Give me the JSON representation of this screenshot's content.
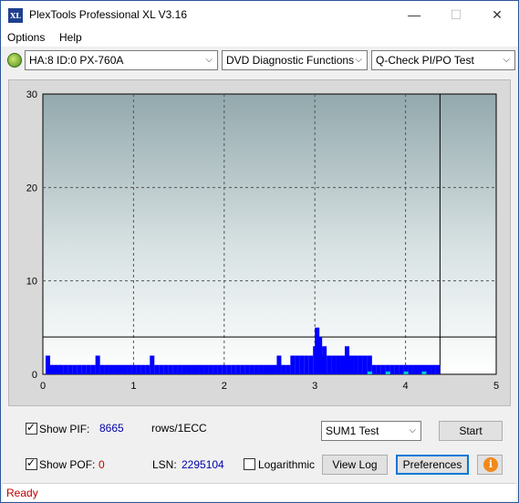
{
  "window": {
    "title": "PlexTools Professional XL V3.16",
    "logo_text": "XL",
    "min_glyph": "—",
    "max_glyph": "☐",
    "close_glyph": "✕"
  },
  "menu": {
    "options": "Options",
    "help": "Help"
  },
  "toolbar": {
    "drive": "HA:8 ID:0  PX-760A",
    "function": "DVD Diagnostic Functions",
    "test": "Q-Check PI/PO Test",
    "arrow": "⌵"
  },
  "chart_data": {
    "type": "bar",
    "xlim": [
      0,
      5
    ],
    "ylim": [
      0,
      30
    ],
    "x_ticks": [
      "0",
      "1",
      "2",
      "3",
      "4",
      "5"
    ],
    "y_ticks": [
      "0",
      "10",
      "20",
      "30"
    ],
    "grid": true,
    "threshold_line": 4,
    "end_marker_x": 4.38,
    "series": [
      {
        "color": "#0000ff",
        "x": [
          0.05,
          0.08,
          0.12,
          0.16,
          0.2,
          0.25,
          0.3,
          0.35,
          0.4,
          0.45,
          0.5,
          0.55,
          0.6,
          0.65,
          0.7,
          0.75,
          0.8,
          0.85,
          0.9,
          0.95,
          1.0,
          1.05,
          1.1,
          1.15,
          1.2,
          1.25,
          1.3,
          1.35,
          1.4,
          1.45,
          1.5,
          1.55,
          1.6,
          1.65,
          1.7,
          1.75,
          1.8,
          1.85,
          1.9,
          1.95,
          2.0,
          2.05,
          2.1,
          2.15,
          2.2,
          2.25,
          2.3,
          2.35,
          2.4,
          2.45,
          2.5,
          2.55,
          2.6,
          2.65,
          2.7,
          2.75,
          2.8,
          2.85,
          2.9,
          2.95,
          3.0,
          3.02,
          3.05,
          3.08,
          3.1,
          3.15,
          3.2,
          3.25,
          3.3,
          3.35,
          3.4,
          3.45,
          3.5,
          3.55,
          3.6,
          3.65,
          3.7,
          3.75,
          3.8,
          3.85,
          3.9,
          3.95,
          4.0,
          4.05,
          4.1,
          4.15,
          4.2,
          4.25,
          4.3,
          4.35
        ],
        "values": [
          2,
          1,
          1,
          1,
          1,
          1,
          1,
          1,
          1,
          1,
          1,
          1,
          2,
          1,
          1,
          1,
          1,
          1,
          1,
          1,
          1,
          1,
          1,
          1,
          2,
          1,
          1,
          1,
          1,
          1,
          1,
          1,
          1,
          1,
          1,
          1,
          1,
          1,
          1,
          1,
          1,
          1,
          1,
          1,
          1,
          1,
          1,
          1,
          1,
          1,
          1,
          1,
          2,
          1,
          1,
          2,
          2,
          2,
          2,
          2,
          3,
          5,
          4,
          2,
          3,
          2,
          2,
          2,
          2,
          3,
          2,
          2,
          2,
          2,
          2,
          1,
          1,
          1,
          1,
          1,
          1,
          1,
          1,
          1,
          1,
          1,
          1,
          1,
          1,
          1
        ]
      },
      {
        "color": "#00c8c8",
        "x": [
          3.6,
          3.8,
          4.0,
          4.2
        ],
        "values": [
          0.3,
          0.3,
          0.3,
          0.3
        ]
      }
    ]
  },
  "bottom": {
    "show_pif_label": "Show PIF:",
    "pif_value": "8665",
    "pif_unit": "rows/1ECC",
    "show_pof_label": "Show POF:",
    "pof_value": "0",
    "lsn_label": "LSN:",
    "lsn_value": "2295104",
    "logarithmic_label": "Logarithmic",
    "test_select": "SUM1 Test",
    "start_button": "Start",
    "view_log_button": "View Log",
    "preferences_button": "Preferences",
    "info_glyph": "i",
    "check_glyph": "✓"
  },
  "status": {
    "text": "Ready"
  }
}
